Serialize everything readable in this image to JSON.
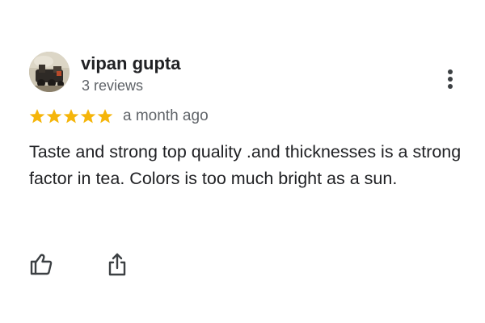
{
  "review": {
    "author_name": "vipan gupta",
    "author_meta": "3 reviews",
    "rating": 5,
    "rating_max": 5,
    "date": "a month ago",
    "text": "Taste and strong top quality .and thicknesses is a strong factor in tea. Colors is too much bright as a sun."
  },
  "icons": {
    "avatar": "avatar-photo",
    "more": "more-vert-icon",
    "star": "star-icon",
    "like": "thumbs-up-icon",
    "share": "share-icon"
  },
  "colors": {
    "star": "#f5b50a",
    "name": "#202124",
    "secondary_text": "#5f6368",
    "icon": "#3c4043"
  }
}
